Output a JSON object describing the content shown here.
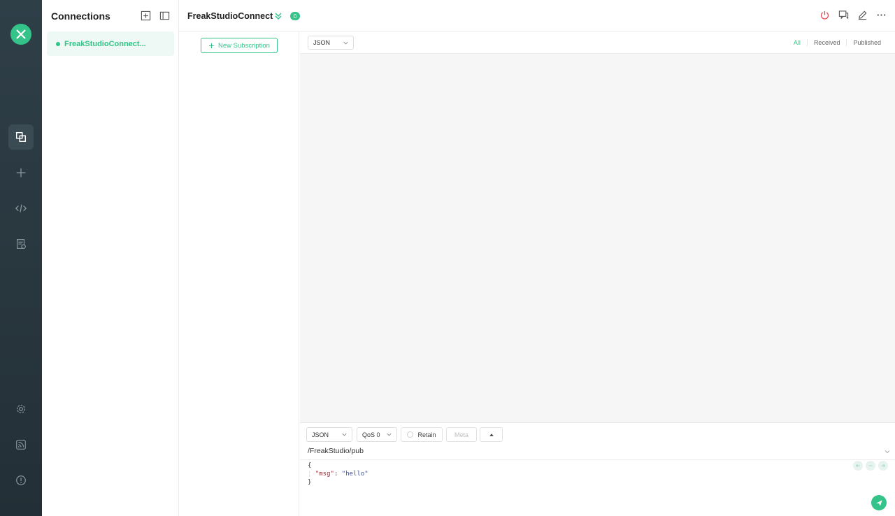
{
  "sidebar": {
    "logo_icon": "mqttx-logo-icon",
    "items": [
      {
        "name": "connections-icon",
        "active": true
      },
      {
        "name": "plus-icon",
        "active": false
      },
      {
        "name": "code-icon",
        "active": false
      },
      {
        "name": "log-icon",
        "active": false
      },
      {
        "name": "gear-icon",
        "active": false
      },
      {
        "name": "feed-icon",
        "active": false
      },
      {
        "name": "info-icon",
        "active": false
      }
    ]
  },
  "connections": {
    "title": "Connections",
    "items": [
      {
        "name": "FreakStudioConnect...",
        "status": "connected"
      }
    ]
  },
  "header": {
    "title": "FreakStudioConnect",
    "badge": "0"
  },
  "subscriptions": {
    "new_button": "New Subscription"
  },
  "messages": {
    "format": "JSON",
    "filters": [
      "All",
      "Received",
      "Published"
    ],
    "active_filter": "All"
  },
  "publish": {
    "format": "JSON",
    "qos": "QoS 0",
    "retain_label": "Retain",
    "meta_label": "Meta",
    "topic": "/FreakStudio/pub",
    "payload": {
      "line1": "{",
      "key": "\"msg\"",
      "value": "\"hello\"",
      "line3": "}"
    }
  },
  "colors": {
    "accent": "#34c388",
    "rail": "#2b3a42",
    "danger": "#e5484d"
  }
}
